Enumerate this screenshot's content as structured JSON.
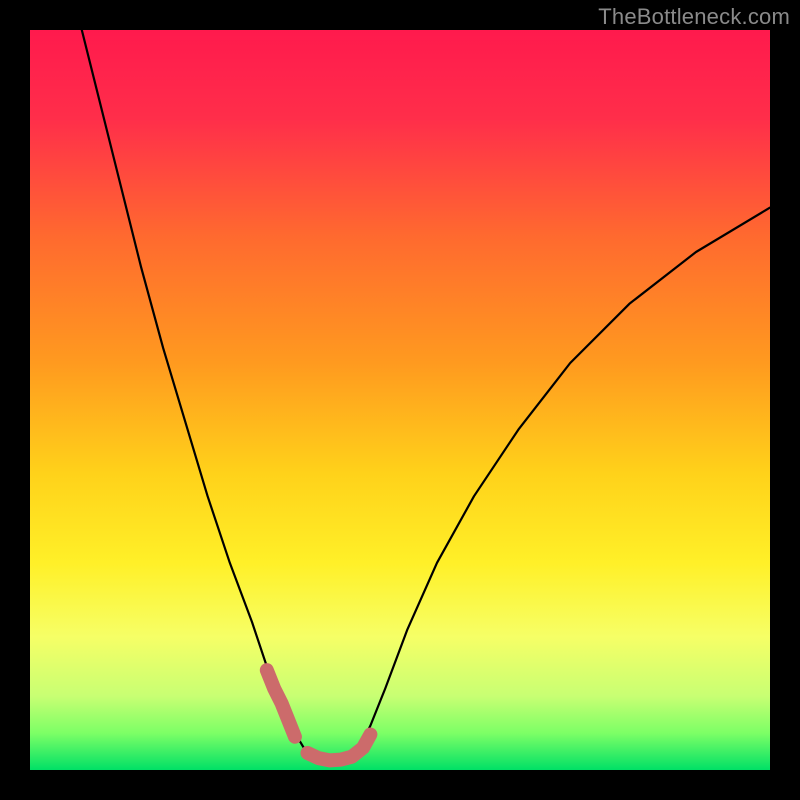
{
  "watermark": "TheBottleneck.com",
  "chart_data": {
    "type": "line",
    "title": "",
    "xlabel": "",
    "ylabel": "",
    "xlim": [
      0,
      100
    ],
    "ylim": [
      0,
      100
    ],
    "gradient_stops": [
      {
        "offset": 0.0,
        "color": "#ff1a4d"
      },
      {
        "offset": 0.12,
        "color": "#ff2e4a"
      },
      {
        "offset": 0.28,
        "color": "#ff6a2f"
      },
      {
        "offset": 0.45,
        "color": "#ff9a1f"
      },
      {
        "offset": 0.6,
        "color": "#ffd21a"
      },
      {
        "offset": 0.72,
        "color": "#fff028"
      },
      {
        "offset": 0.82,
        "color": "#f6ff66"
      },
      {
        "offset": 0.9,
        "color": "#c8ff73"
      },
      {
        "offset": 0.95,
        "color": "#7dff66"
      },
      {
        "offset": 1.0,
        "color": "#00e066"
      }
    ],
    "series": [
      {
        "name": "bottleneck-curve",
        "color": "#000000",
        "stroke_width": 2.2,
        "points": [
          {
            "x": 7.0,
            "y": 100.0
          },
          {
            "x": 9.0,
            "y": 92.0
          },
          {
            "x": 12.0,
            "y": 80.0
          },
          {
            "x": 15.0,
            "y": 68.0
          },
          {
            "x": 18.0,
            "y": 57.0
          },
          {
            "x": 21.0,
            "y": 47.0
          },
          {
            "x": 24.0,
            "y": 37.0
          },
          {
            "x": 27.0,
            "y": 28.0
          },
          {
            "x": 30.0,
            "y": 20.0
          },
          {
            "x": 32.0,
            "y": 14.0
          },
          {
            "x": 34.0,
            "y": 9.0
          },
          {
            "x": 35.5,
            "y": 5.5
          },
          {
            "x": 37.0,
            "y": 3.0
          },
          {
            "x": 38.5,
            "y": 1.5
          },
          {
            "x": 40.0,
            "y": 1.0
          },
          {
            "x": 41.5,
            "y": 1.0
          },
          {
            "x": 43.0,
            "y": 1.5
          },
          {
            "x": 44.5,
            "y": 3.0
          },
          {
            "x": 46.0,
            "y": 6.0
          },
          {
            "x": 48.0,
            "y": 11.0
          },
          {
            "x": 51.0,
            "y": 19.0
          },
          {
            "x": 55.0,
            "y": 28.0
          },
          {
            "x": 60.0,
            "y": 37.0
          },
          {
            "x": 66.0,
            "y": 46.0
          },
          {
            "x": 73.0,
            "y": 55.0
          },
          {
            "x": 81.0,
            "y": 63.0
          },
          {
            "x": 90.0,
            "y": 70.0
          },
          {
            "x": 100.0,
            "y": 76.0
          }
        ]
      },
      {
        "name": "marker-left",
        "color": "#cc6b6b",
        "stroke_width": 14,
        "points": [
          {
            "x": 32.0,
            "y": 13.5
          },
          {
            "x": 33.0,
            "y": 11.0
          },
          {
            "x": 34.0,
            "y": 9.0
          },
          {
            "x": 35.0,
            "y": 6.5
          },
          {
            "x": 35.8,
            "y": 4.5
          }
        ]
      },
      {
        "name": "marker-bottom",
        "color": "#cc6b6b",
        "stroke_width": 14,
        "points": [
          {
            "x": 37.5,
            "y": 2.3
          },
          {
            "x": 39.0,
            "y": 1.6
          },
          {
            "x": 40.5,
            "y": 1.3
          },
          {
            "x": 42.0,
            "y": 1.4
          },
          {
            "x": 43.5,
            "y": 1.8
          },
          {
            "x": 45.0,
            "y": 3.0
          },
          {
            "x": 46.0,
            "y": 4.8
          }
        ]
      }
    ]
  }
}
